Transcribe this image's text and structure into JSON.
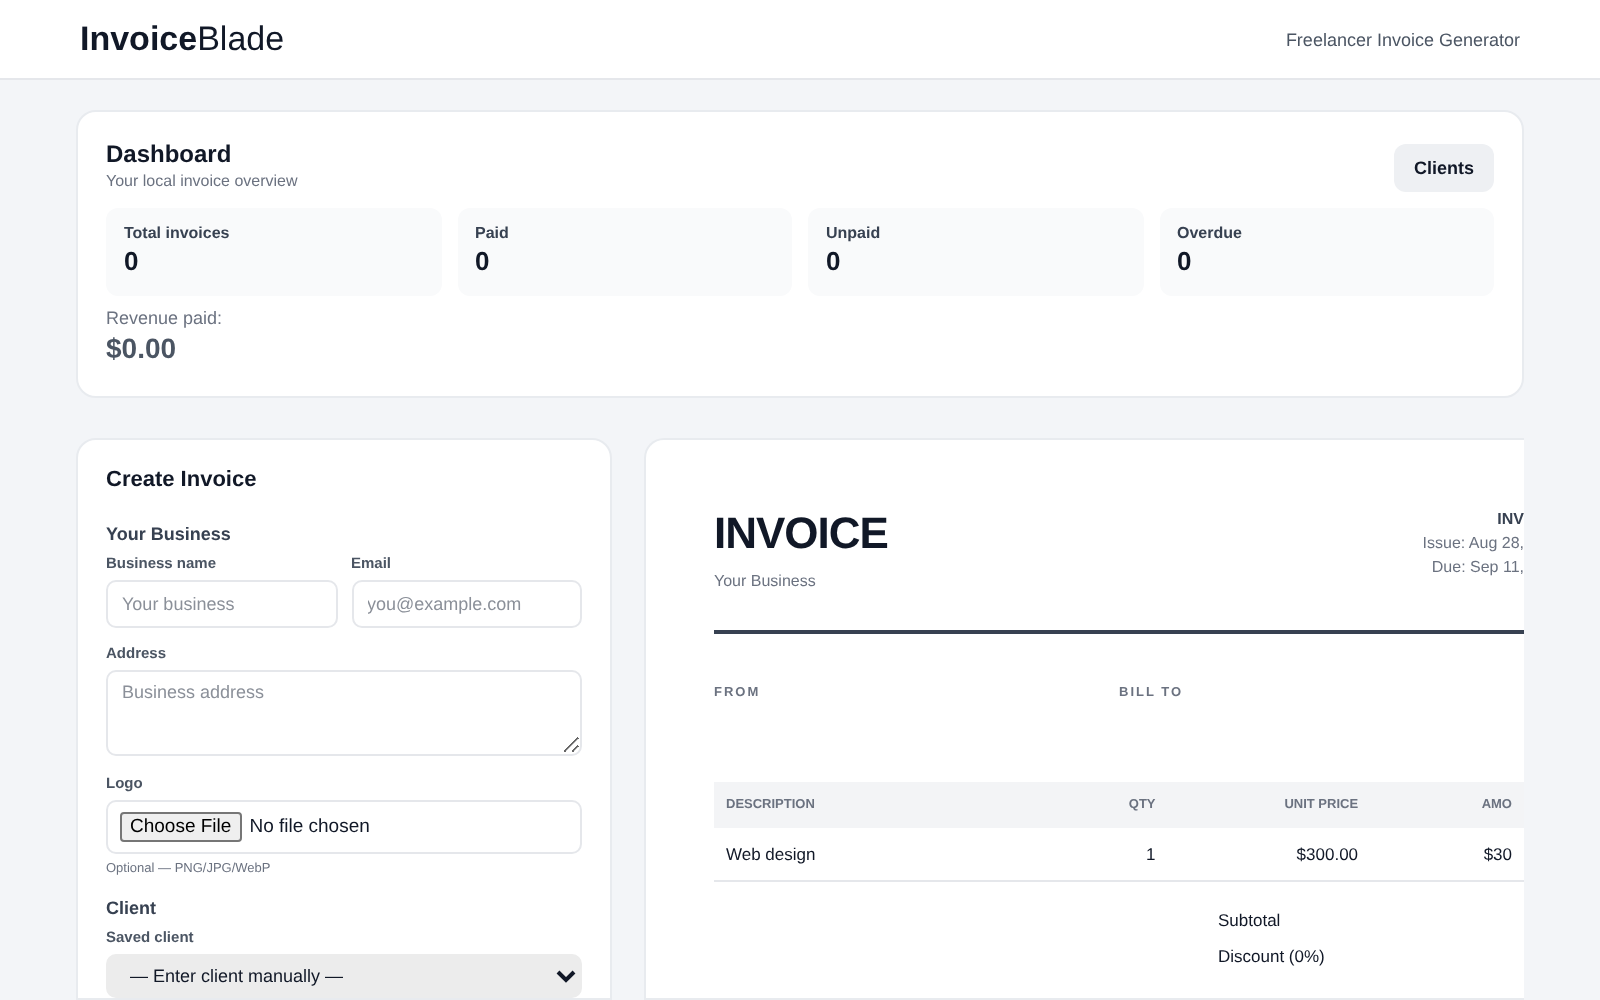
{
  "header": {
    "logo_bold": "Invoice",
    "logo_rest": "Blade",
    "tagline": "Freelancer Invoice Generator"
  },
  "dashboard": {
    "title": "Dashboard",
    "subtitle": "Your local invoice overview",
    "button": "Clients",
    "stats": [
      {
        "label": "Total invoices",
        "value": "0"
      },
      {
        "label": "Paid",
        "value": "0"
      },
      {
        "label": "Unpaid",
        "value": "0"
      },
      {
        "label": "Overdue",
        "value": "0"
      }
    ],
    "revenue_label": "Revenue paid:",
    "revenue_value": "$0.00"
  },
  "form": {
    "title": "Create Invoice",
    "business_heading": "Your Business",
    "name_label": "Business name",
    "name_placeholder": "Your business",
    "email_label": "Email",
    "email_placeholder": "you@example.com",
    "address_label": "Address",
    "address_placeholder": "Business address",
    "logo_label": "Logo",
    "file_button": "Choose File",
    "file_status": "No file chosen",
    "logo_hint": "Optional — PNG/JPG/WebP",
    "client_heading": "Client",
    "saved_label": "Saved client",
    "saved_value": "— Enter client manually —"
  },
  "preview": {
    "title": "INVOICE",
    "business": "Your Business",
    "number": "INV",
    "issue": "Issue: Aug 28,",
    "due": "Due: Sep 11,",
    "from_label": "FROM",
    "bill_to_label": "BILL TO",
    "columns": [
      "DESCRIPTION",
      "QTY",
      "UNIT PRICE",
      "AMO"
    ],
    "rows": [
      [
        "Web design",
        "1",
        "$300.00",
        "$30"
      ]
    ],
    "totals": [
      {
        "label": "Subtotal"
      },
      {
        "label": "Discount (0%)"
      }
    ]
  }
}
